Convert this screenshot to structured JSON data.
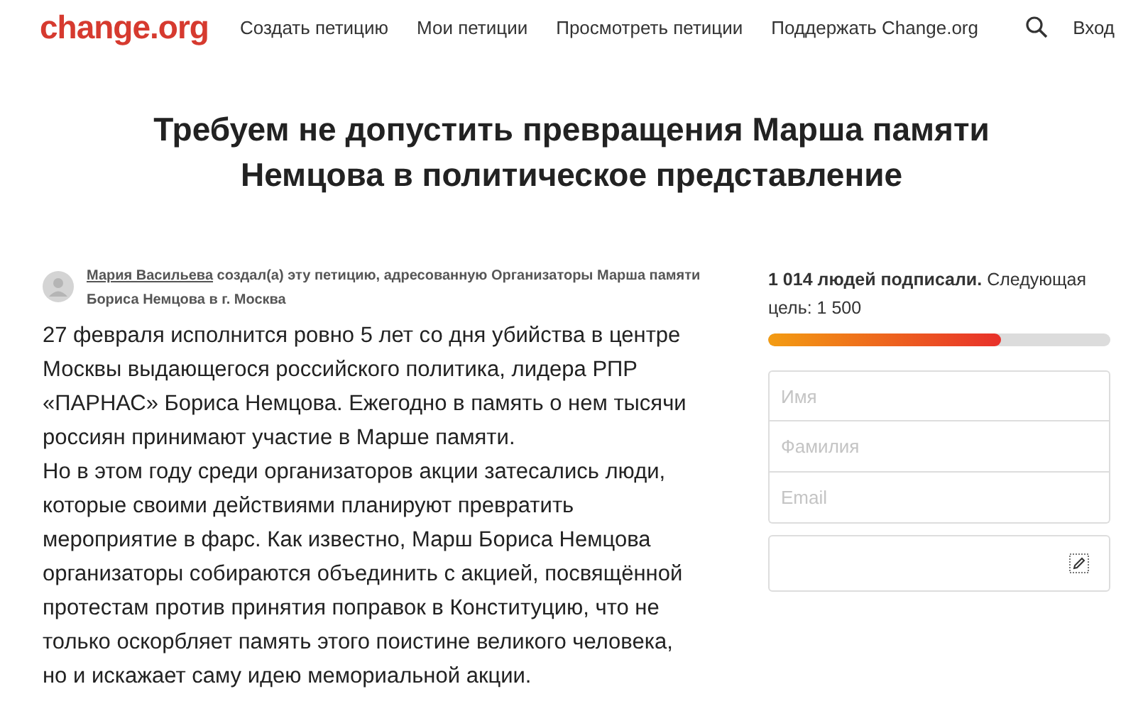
{
  "header": {
    "logo": "change.org",
    "nav": [
      "Создать петицию",
      "Мои петиции",
      "Просмотреть петиции",
      "Поддержать Change.org"
    ],
    "login": "Вход"
  },
  "title": "Требуем не допустить превращения Марша памяти Немцова в политическое представление",
  "creator": {
    "author": "Мария Васильева",
    "text": "создал(а) эту петицию, адресованную Организаторы Марша памяти Бориса Немцова в г. Москва"
  },
  "body": [
    "27 февраля исполнится ровно 5 лет со дня убийства в центре Москвы выдающегося российского политика, лидера РПР «ПАРНАС» Бориса Немцова. Ежегодно в память о нем тысячи россиян принимают участие в Марше памяти.",
    "Но в этом году среди организаторов акции затесались люди, которые своими действиями планируют превратить мероприятие в фарс. Как известно, Марш Бориса Немцова организаторы собираются объединить с акцией, посвящённой протестам против принятия поправок в Конституцию, что не только оскорбляет память этого поистине великого человека, но и искажает саму идею мемориальной акции."
  ],
  "progress": {
    "caption": "**1 014 людей подписали.** Следующая цель: 1 500",
    "level": 0.68
  },
  "form": {
    "fields": [
      {
        "placeholder": "Имя"
      },
      {
        "placeholder": "Фамилия"
      },
      {
        "placeholder": "Email"
      }
    ]
  }
}
